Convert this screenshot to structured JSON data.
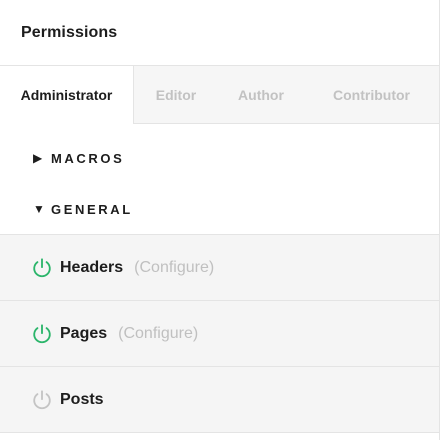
{
  "header": {
    "title": "Permissions"
  },
  "tabs": [
    {
      "label": "Administrator",
      "active": true
    },
    {
      "label": "Editor",
      "active": false
    },
    {
      "label": "Author",
      "active": false
    },
    {
      "label": "Contributor",
      "active": false
    }
  ],
  "groups": [
    {
      "label": "MACROS",
      "expanded": false,
      "arrow": "▶"
    },
    {
      "label": "GENERAL",
      "expanded": true,
      "arrow": "▼"
    }
  ],
  "items": [
    {
      "label": "Headers",
      "configure": "(Configure)",
      "enabled": true,
      "icon": "power-icon"
    },
    {
      "label": "Pages",
      "configure": "(Configure)",
      "enabled": true,
      "icon": "power-icon"
    },
    {
      "label": "Posts",
      "configure": "",
      "enabled": false,
      "icon": "power-icon"
    }
  ],
  "colors": {
    "enabled": "#2bb56a",
    "disabled": "#c4c4c4",
    "text": "#1d1d1d",
    "muted": "#c0c0c0"
  }
}
